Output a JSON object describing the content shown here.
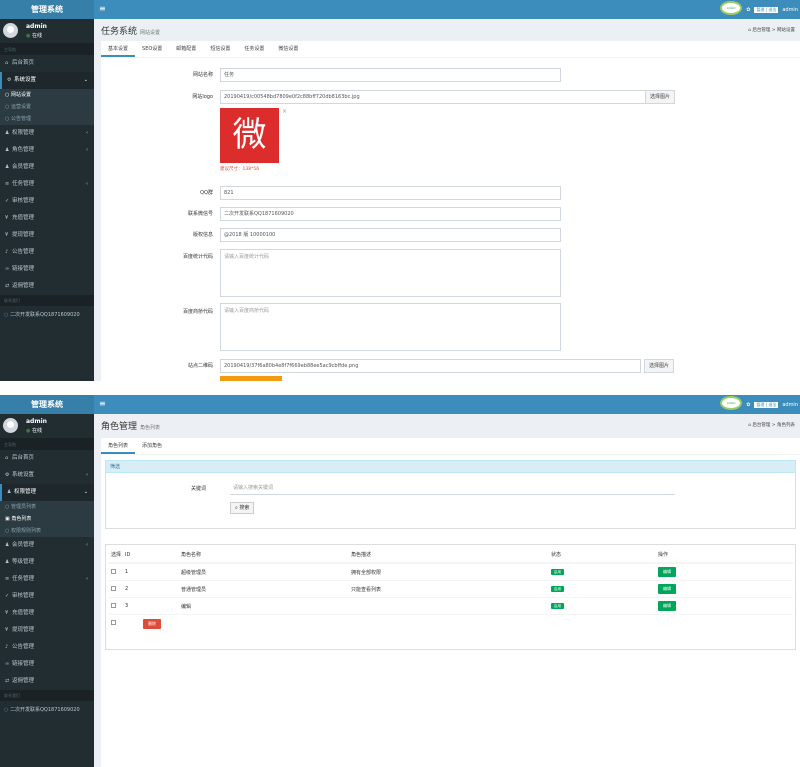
{
  "app": {
    "title": "管理系统",
    "toggle": "≡"
  },
  "topbar": {
    "badge": "LOGO",
    "user": "admin",
    "mini": "管理 | 退出"
  },
  "user": {
    "name": "admin",
    "status": "在线"
  },
  "shot1": {
    "sidebar": {
      "header": "主导航",
      "items": [
        {
          "label": "后台首页",
          "icon": "home-icon"
        },
        {
          "label": "系统设置",
          "icon": "gear-icon",
          "open": true,
          "sub": [
            "网站设置",
            "运营设置",
            "公告管理"
          ]
        },
        {
          "label": "权限管理",
          "icon": "users-icon"
        },
        {
          "label": "角色管理",
          "icon": "users-icon"
        },
        {
          "label": "会员管理",
          "icon": "user-icon"
        },
        {
          "label": "任务管理",
          "icon": "list-icon"
        },
        {
          "label": "审核管理",
          "icon": "check-icon"
        },
        {
          "label": "充值管理",
          "icon": "money-icon"
        },
        {
          "label": "提现管理",
          "icon": "money-icon"
        },
        {
          "label": "公告管理",
          "icon": "bell-icon"
        },
        {
          "label": "链接管理",
          "icon": "link-icon"
        },
        {
          "label": "返佣管理",
          "icon": "share-icon"
        }
      ],
      "footer_head": "联系我们",
      "footer": "二次开发联系QQ1871609020"
    },
    "header": {
      "title": "任务系统",
      "subtitle": "网站设置",
      "breadcrumb": "后台管理 > 网站设置"
    },
    "tabs": [
      "基本设置",
      "SEO设置",
      "邮箱配置",
      "短信设置",
      "任务设置",
      "微信设置"
    ],
    "form": {
      "site_name": {
        "label": "网站名称",
        "value": "任务"
      },
      "logo": {
        "label": "网站logo",
        "value": "20190419/c00548bd7809e0f2c88bff720db8163bc.jpg",
        "button": "选择图片",
        "image_char": "微",
        "hint": "建议尺寸：138*56"
      },
      "qq": {
        "label": "QQ群",
        "value": "821"
      },
      "service": {
        "label": "联系微信号",
        "value": "二次开发联系QQ1871609020"
      },
      "copyright": {
        "label": "版权信息",
        "value": "@2018 版 10000100"
      },
      "stat_code": {
        "label": "百度统计代码",
        "placeholder": "请输入百度统计代码"
      },
      "share_code": {
        "label": "百度商桥代码",
        "placeholder": "请输入百度商桥代码"
      },
      "qrcode": {
        "label": "站点二维码",
        "value": "20190419/37f6a80b4e8f7f669eb88ee5ac9cbffde.png",
        "button": "选择图片"
      }
    }
  },
  "shot2": {
    "sidebar": {
      "header": "主导航",
      "items": [
        {
          "label": "后台首页",
          "icon": "home-icon"
        },
        {
          "label": "系统设置",
          "icon": "gear-icon"
        },
        {
          "label": "权限管理",
          "icon": "users-icon",
          "open": true,
          "sub": [
            "管理员列表",
            "角色列表",
            "权限规则列表"
          ]
        },
        {
          "label": "会员管理",
          "icon": "users-icon"
        },
        {
          "label": "等级管理",
          "icon": "user-icon"
        },
        {
          "label": "任务管理",
          "icon": "list-icon"
        },
        {
          "label": "审核管理",
          "icon": "check-icon"
        },
        {
          "label": "充值管理",
          "icon": "money-icon"
        },
        {
          "label": "提现管理",
          "icon": "money-icon"
        },
        {
          "label": "公告管理",
          "icon": "bell-icon"
        },
        {
          "label": "链接管理",
          "icon": "link-icon"
        },
        {
          "label": "返佣管理",
          "icon": "share-icon"
        }
      ],
      "footer_head": "联系我们",
      "footer": "二次开发联系QQ1871609020"
    },
    "header": {
      "title": "角色管理",
      "subtitle": "角色列表",
      "breadcrumb": "后台管理 > 角色列表"
    },
    "tabs": [
      "角色列表",
      "添加角色"
    ],
    "search": {
      "title": "筛选",
      "label": "关键词",
      "placeholder": "请输入搜索关键词",
      "button": "搜索"
    },
    "table": {
      "headers": [
        "选择",
        "ID",
        "角色名称",
        "角色描述",
        "状态",
        "操作"
      ],
      "rows": [
        {
          "id": "1",
          "name": "超级管理员",
          "desc": "拥有全部权限",
          "status": "启用",
          "action": "编辑"
        },
        {
          "id": "2",
          "name": "普通管理员",
          "desc": "只能查看列表",
          "status": "启用",
          "action": "编辑"
        },
        {
          "id": "3",
          "name": "编辑",
          "desc": "",
          "status": "启用",
          "action": "编辑"
        }
      ],
      "delete": "删除"
    }
  }
}
